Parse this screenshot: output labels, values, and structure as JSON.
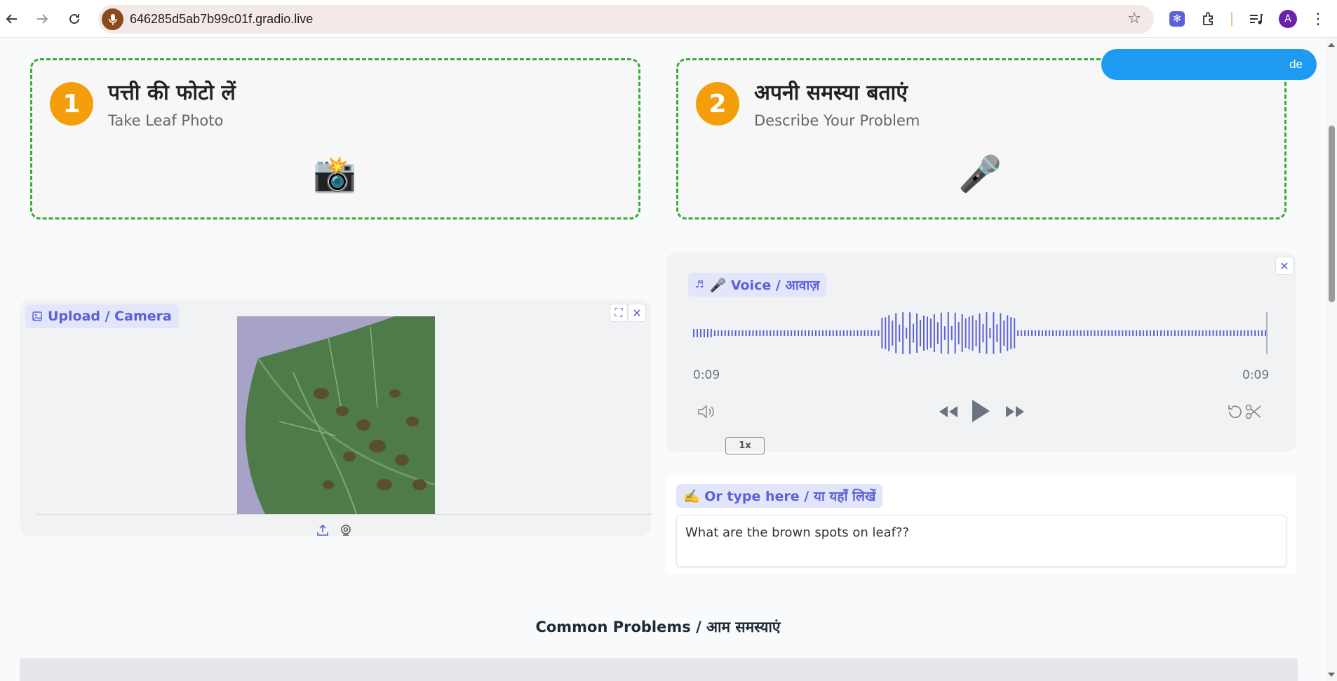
{
  "browser": {
    "url": "646285d5ab7b99c01f.gradio.live",
    "profile_initial": "A"
  },
  "float_button": {
    "label": "de"
  },
  "steps": [
    {
      "number": "1",
      "title_hi": "पत्ती की फोटो लें",
      "title_en": "Take Leaf Photo",
      "icon": "📸"
    },
    {
      "number": "2",
      "title_hi": "अपनी समस्या बताएं",
      "title_en": "Describe Your Problem",
      "icon": "🎤"
    }
  ],
  "image_upload": {
    "label": "Upload / Camera",
    "image_alt": "leaf with brown spots"
  },
  "audio": {
    "label": "🎤 Voice / आवाज़",
    "current_time": "0:09",
    "duration": "0:09",
    "speed": "1x"
  },
  "text_input": {
    "label": "✍️ Or type here / या यहाँ लिखें",
    "value": "What are the brown spots on leaf??"
  },
  "common_problems": {
    "title": "Common Problems / आम समस्याएं"
  },
  "colors": {
    "accent": "#5b61d6",
    "step_badge": "#f59e0b",
    "dashed_border": "#3aab3a",
    "float_button": "#1e9bf0"
  }
}
